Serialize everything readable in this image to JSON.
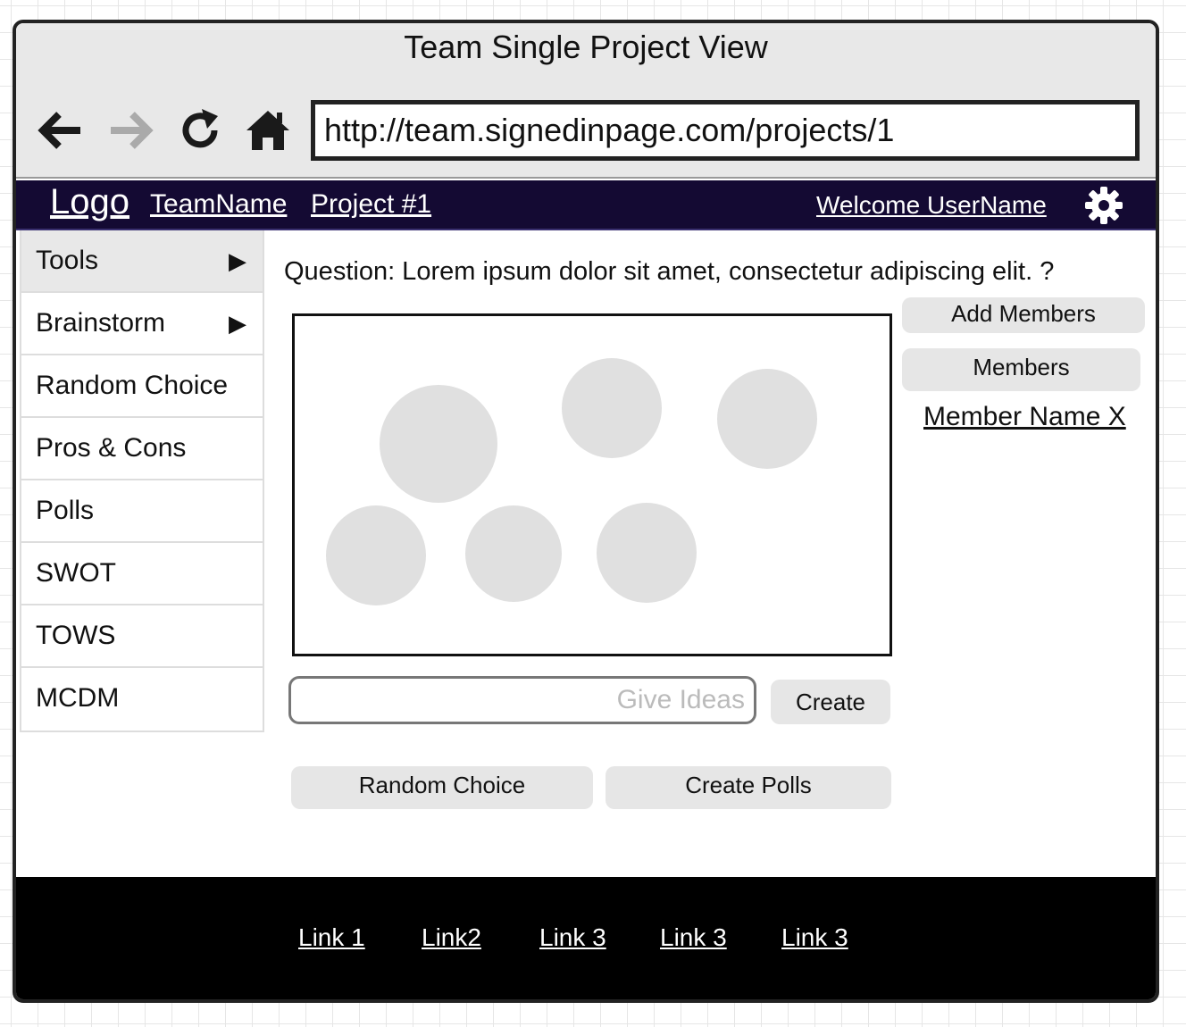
{
  "window": {
    "title": "Team Single Project View"
  },
  "browser": {
    "url": "http://team.signedinpage.com/projects/1",
    "icons": [
      "back-arrow-icon",
      "forward-arrow-icon",
      "reload-icon",
      "home-icon"
    ]
  },
  "topnav": {
    "logo": "Logo",
    "team_name": "TeamName",
    "project": "Project #1",
    "welcome": "Welcome UserName",
    "settings_icon": "gear-icon",
    "background_color": "#140a33"
  },
  "sidebar": {
    "items": [
      {
        "label": "Tools",
        "arrow": "▶"
      },
      {
        "label": "Brainstorm",
        "arrow": "▶"
      },
      {
        "label": "Random Choice"
      },
      {
        "label": "Pros & Cons"
      },
      {
        "label": "Polls"
      },
      {
        "label": "SWOT"
      },
      {
        "label": "TOWS"
      },
      {
        "label": "MCDM"
      }
    ]
  },
  "main": {
    "question": "Question: Lorem ipsum dolor sit amet, consectetur adipiscing elit. ?",
    "idea_input_placeholder": "Give Ideas",
    "create_label": "Create",
    "random_choice_label": "Random Choice",
    "create_polls_label": "Create Polls"
  },
  "members": {
    "add_label": "Add Members",
    "members_label": "Members",
    "member_name": "Member Name X"
  },
  "footer": {
    "links": [
      "Link 1",
      "Link2",
      "Link 3",
      "Link 3",
      "Link 3"
    ]
  }
}
